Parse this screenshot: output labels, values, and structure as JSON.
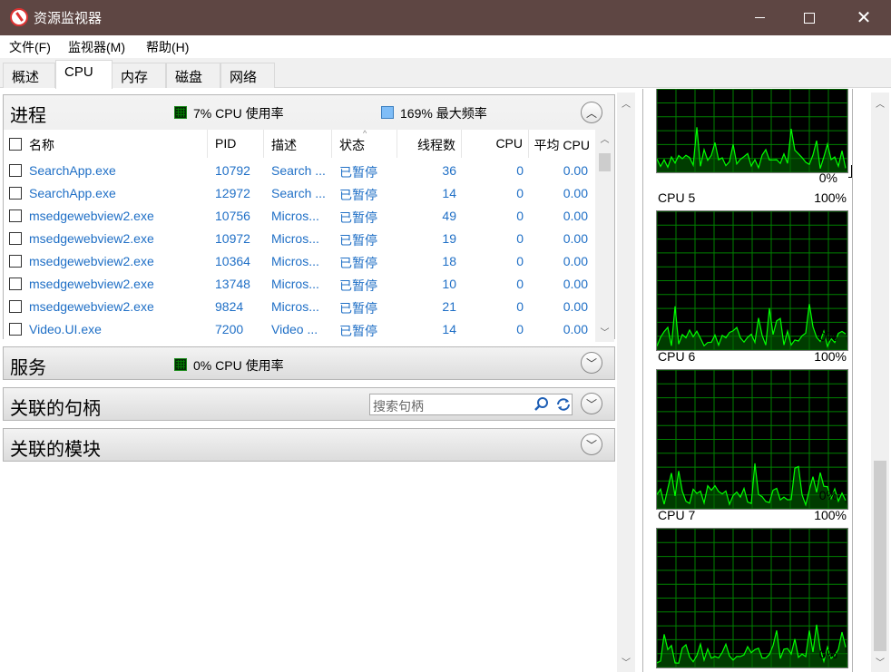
{
  "window": {
    "title": "资源监视器"
  },
  "menu": [
    {
      "label": "文件(F)"
    },
    {
      "label": "监视器(M)"
    },
    {
      "label": "帮助(H)"
    }
  ],
  "tabs": [
    {
      "label": "概述"
    },
    {
      "label": "CPU"
    },
    {
      "label": "内存"
    },
    {
      "label": "磁盘"
    },
    {
      "label": "网络"
    }
  ],
  "active_tab": "CPU",
  "processes": {
    "title": "进程",
    "cpu_usage": "7% CPU 使用率",
    "max_freq": "169% 最大频率",
    "columns": [
      "名称",
      "PID",
      "描述",
      "状态",
      "线程数",
      "CPU",
      "平均 CPU"
    ],
    "rows": [
      {
        "name": "SearchApp.exe",
        "pid": "10792",
        "desc": "Search ...",
        "status": "已暂停",
        "threads": "36",
        "cpu": "0",
        "avg": "0.00"
      },
      {
        "name": "SearchApp.exe",
        "pid": "12972",
        "desc": "Search ...",
        "status": "已暂停",
        "threads": "14",
        "cpu": "0",
        "avg": "0.00"
      },
      {
        "name": "msedgewebview2.exe",
        "pid": "10756",
        "desc": "Micros...",
        "status": "已暂停",
        "threads": "49",
        "cpu": "0",
        "avg": "0.00"
      },
      {
        "name": "msedgewebview2.exe",
        "pid": "10972",
        "desc": "Micros...",
        "status": "已暂停",
        "threads": "19",
        "cpu": "0",
        "avg": "0.00"
      },
      {
        "name": "msedgewebview2.exe",
        "pid": "10364",
        "desc": "Micros...",
        "status": "已暂停",
        "threads": "18",
        "cpu": "0",
        "avg": "0.00"
      },
      {
        "name": "msedgewebview2.exe",
        "pid": "13748",
        "desc": "Micros...",
        "status": "已暂停",
        "threads": "10",
        "cpu": "0",
        "avg": "0.00"
      },
      {
        "name": "msedgewebview2.exe",
        "pid": "9824",
        "desc": "Micros...",
        "status": "已暂停",
        "threads": "21",
        "cpu": "0",
        "avg": "0.00"
      },
      {
        "name": "Video.UI.exe",
        "pid": "7200",
        "desc": "Video ...",
        "status": "已暂停",
        "threads": "14",
        "cpu": "0",
        "avg": "0.00"
      }
    ]
  },
  "services": {
    "title": "服务",
    "cpu_usage": "0% CPU 使用率"
  },
  "handles": {
    "title": "关联的句柄",
    "search_placeholder": "搜索句柄"
  },
  "modules": {
    "title": "关联的模块"
  },
  "graphs": {
    "top_partial": {
      "min_label": "0%"
    },
    "items": [
      {
        "label": "CPU 5",
        "max_label": "100%",
        "min_label": "0%"
      },
      {
        "label": "CPU 6",
        "max_label": "100%",
        "min_label": "0%"
      },
      {
        "label": "CPU 7",
        "max_label": "100%",
        "min_label": "0%"
      }
    ]
  },
  "colors": {
    "titlebar": "#5e4643",
    "link": "#1f6fc6",
    "graph_line": "#00ff00",
    "graph_grid": "#008000"
  }
}
